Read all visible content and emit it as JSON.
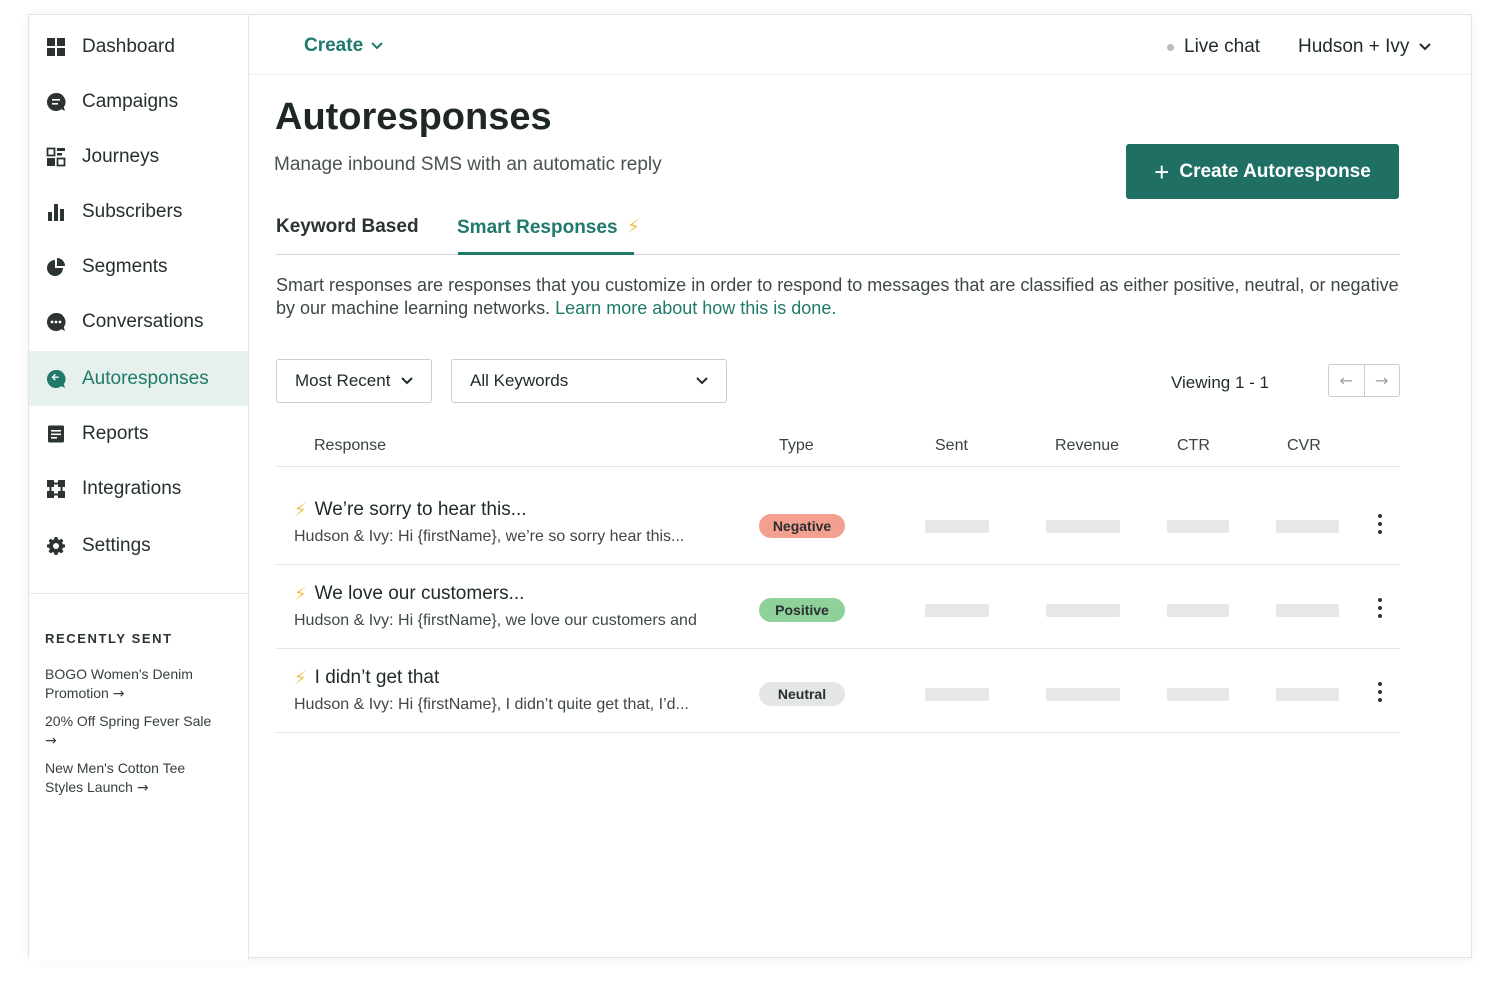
{
  "sidebar": {
    "items": [
      {
        "label": "Dashboard",
        "icon": "dashboard-icon",
        "active": false
      },
      {
        "label": "Campaigns",
        "icon": "campaigns-icon",
        "active": false
      },
      {
        "label": "Journeys",
        "icon": "journeys-icon",
        "active": false
      },
      {
        "label": "Subscribers",
        "icon": "subscribers-icon",
        "active": false
      },
      {
        "label": "Segments",
        "icon": "segments-icon",
        "active": false
      },
      {
        "label": "Conversations",
        "icon": "conversations-icon",
        "active": false
      },
      {
        "label": "Autoresponses",
        "icon": "autoresponses-icon",
        "active": true
      },
      {
        "label": "Reports",
        "icon": "reports-icon",
        "active": false
      },
      {
        "label": "Integrations",
        "icon": "integrations-icon",
        "active": false
      },
      {
        "label": "Settings",
        "icon": "settings-icon",
        "active": false
      }
    ],
    "recent_title": "RECENTLY SENT",
    "recent": [
      {
        "label": "BOGO Women's Denim Promotion"
      },
      {
        "label": "20% Off Spring Fever Sale"
      },
      {
        "label": "New Men's Cotton Tee Styles Launch"
      }
    ],
    "recent_arrow": "→"
  },
  "topbar": {
    "create_label": "Create",
    "live_chat_label": "Live chat",
    "account_label": "Hudson + Ivy"
  },
  "page": {
    "title": "Autoresponses",
    "subtitle": "Manage inbound SMS with an automatic reply",
    "create_button_plus": "+",
    "create_button_label": "Create Autoresponse",
    "tabs": [
      {
        "label": "Keyword Based",
        "active": false
      },
      {
        "label": "Smart Responses",
        "active": true
      }
    ],
    "tab_bolt": "⚡",
    "description": "Smart responses are responses that you customize in order to respond to messages that are classified as either positive, neutral, or negative by our machine learning networks.",
    "learn_more": "Learn more about how this is done."
  },
  "filters": {
    "sort_value": "Most Recent",
    "keywords_value": "All Keywords",
    "viewing": "Viewing 1 - 1",
    "prev_arrow": "←",
    "next_arrow": "→"
  },
  "table": {
    "columns": [
      "Response",
      "Type",
      "Sent",
      "Revenue",
      "CTR",
      "CVR"
    ],
    "rows": [
      {
        "title": "We’re sorry to hear this...",
        "preview": "Hudson & Ivy: Hi {firstName}, we’re so sorry hear this...",
        "type": "Negative",
        "badge_color": "#f4a090"
      },
      {
        "title": "We love our customers...",
        "preview": "Hudson & Ivy: Hi {firstName}, we love our customers and",
        "type": "Positive",
        "badge_color": "#8fd19a"
      },
      {
        "title": "I didn’t get that",
        "preview": "Hudson & Ivy: Hi {firstName}, I didn’t quite get that, I’d...",
        "type": "Neutral",
        "badge_color": "#e4e6e6"
      }
    ],
    "row_bolt": "⚡"
  },
  "colors": {
    "brand": "#1f6f64",
    "accent_text": "#1f7a6b",
    "active_nav_bg": "#e6f0ec",
    "bolt": "#f2c14e"
  }
}
